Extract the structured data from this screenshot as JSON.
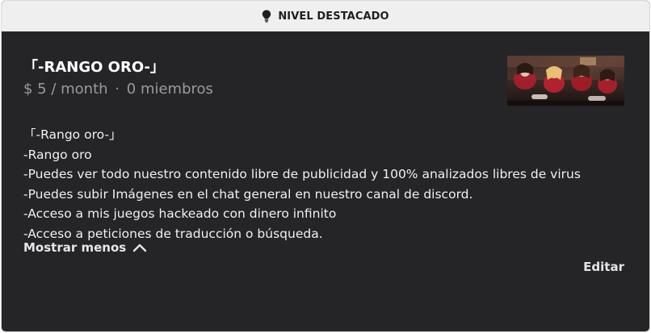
{
  "banner": {
    "label": "NIVEL DESTACADO",
    "icon": "lightbulb-icon"
  },
  "tier": {
    "name": "「-RANGO ORO-」",
    "price": "$ 5 / month",
    "separator": "·",
    "members": "0 miembros",
    "thumbnail_icon": "tier-image"
  },
  "description": [
    "「-Rango oro-」",
    "-Rango oro",
    "-Puedes ver todo nuestro contenido libre de publicidad y 100% analizados libres de virus",
    "-Puedes subir Imágenes en el chat general en nuestro canal de discord.",
    "-Acceso a mis juegos hackeado con dinero infinito",
    "-Acceso a peticiones de traducción o búsqueda."
  ],
  "actions": {
    "show_less": "Mostrar menos",
    "show_less_icon": "chevron-up-icon",
    "edit": "Editar"
  },
  "colors": {
    "card_bg": "#252527",
    "banner_bg": "#efefef",
    "muted_text": "#9a9a9a"
  }
}
